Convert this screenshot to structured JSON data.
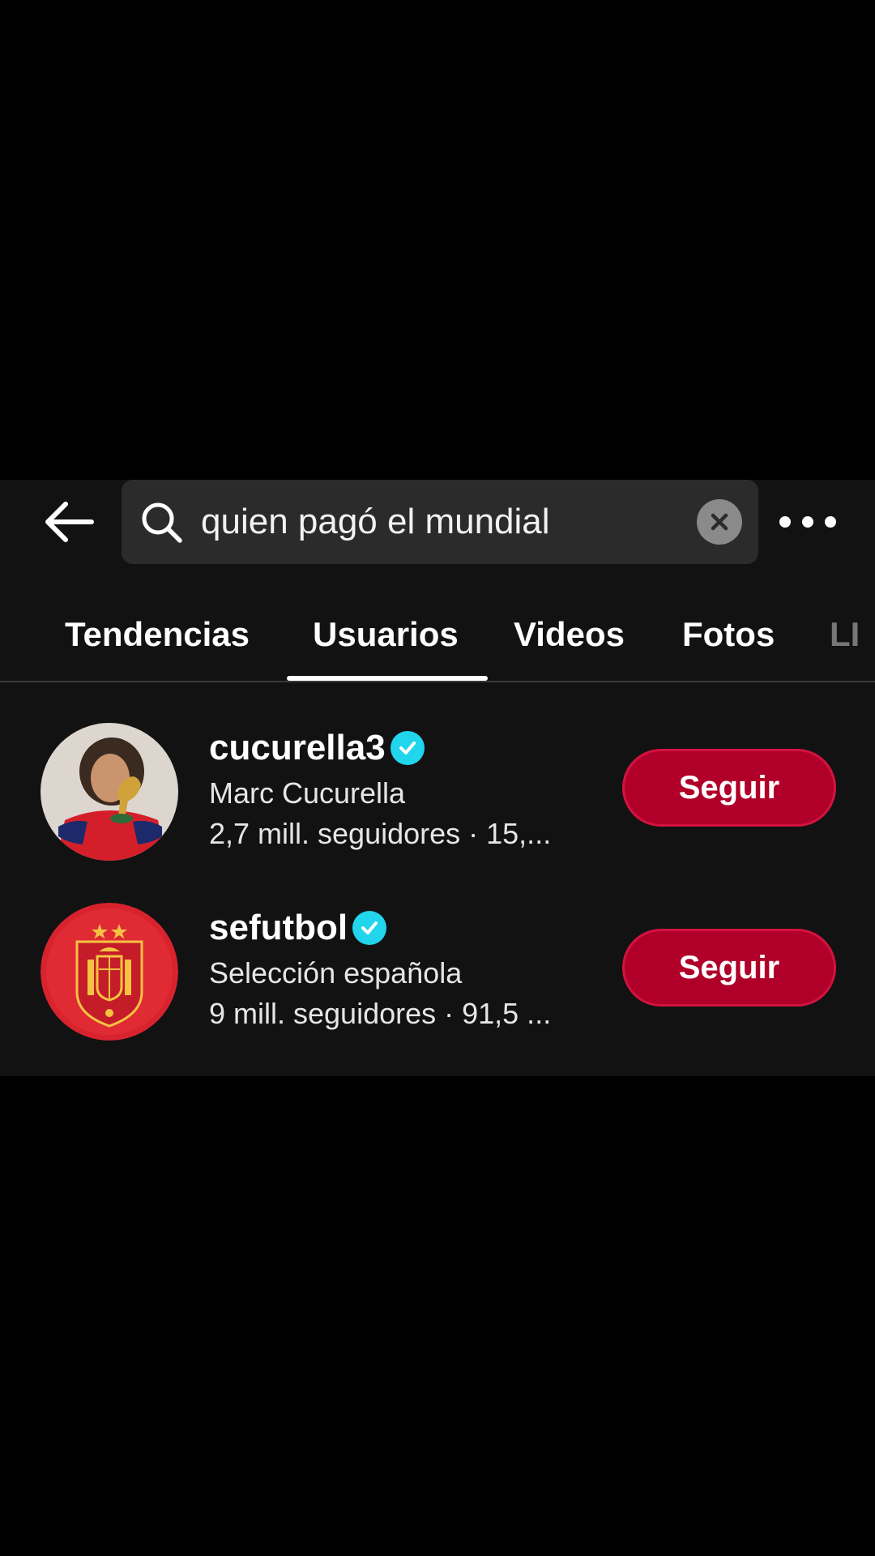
{
  "search": {
    "query": "quien pagó el mundial"
  },
  "tabs": [
    {
      "label": "Tendencias"
    },
    {
      "label": "Usuarios"
    },
    {
      "label": "Videos"
    },
    {
      "label": "Fotos"
    },
    {
      "label": "LI"
    }
  ],
  "active_tab": "Usuarios",
  "users": [
    {
      "username": "cucurella3",
      "display_name": "Marc Cucurella",
      "stats": "2,7 mill. seguidores · 15,...",
      "verified": true,
      "follow_label": "Seguir"
    },
    {
      "username": "sefutbol",
      "display_name": "Selección española",
      "stats": "9 mill. seguidores · 91,5 ...",
      "verified": true,
      "follow_label": "Seguir"
    }
  ],
  "colors": {
    "follow_button": "#b0002a",
    "verified_badge": "#20d5ec",
    "panel_background": "#121212",
    "search_background": "#2b2b2b"
  }
}
